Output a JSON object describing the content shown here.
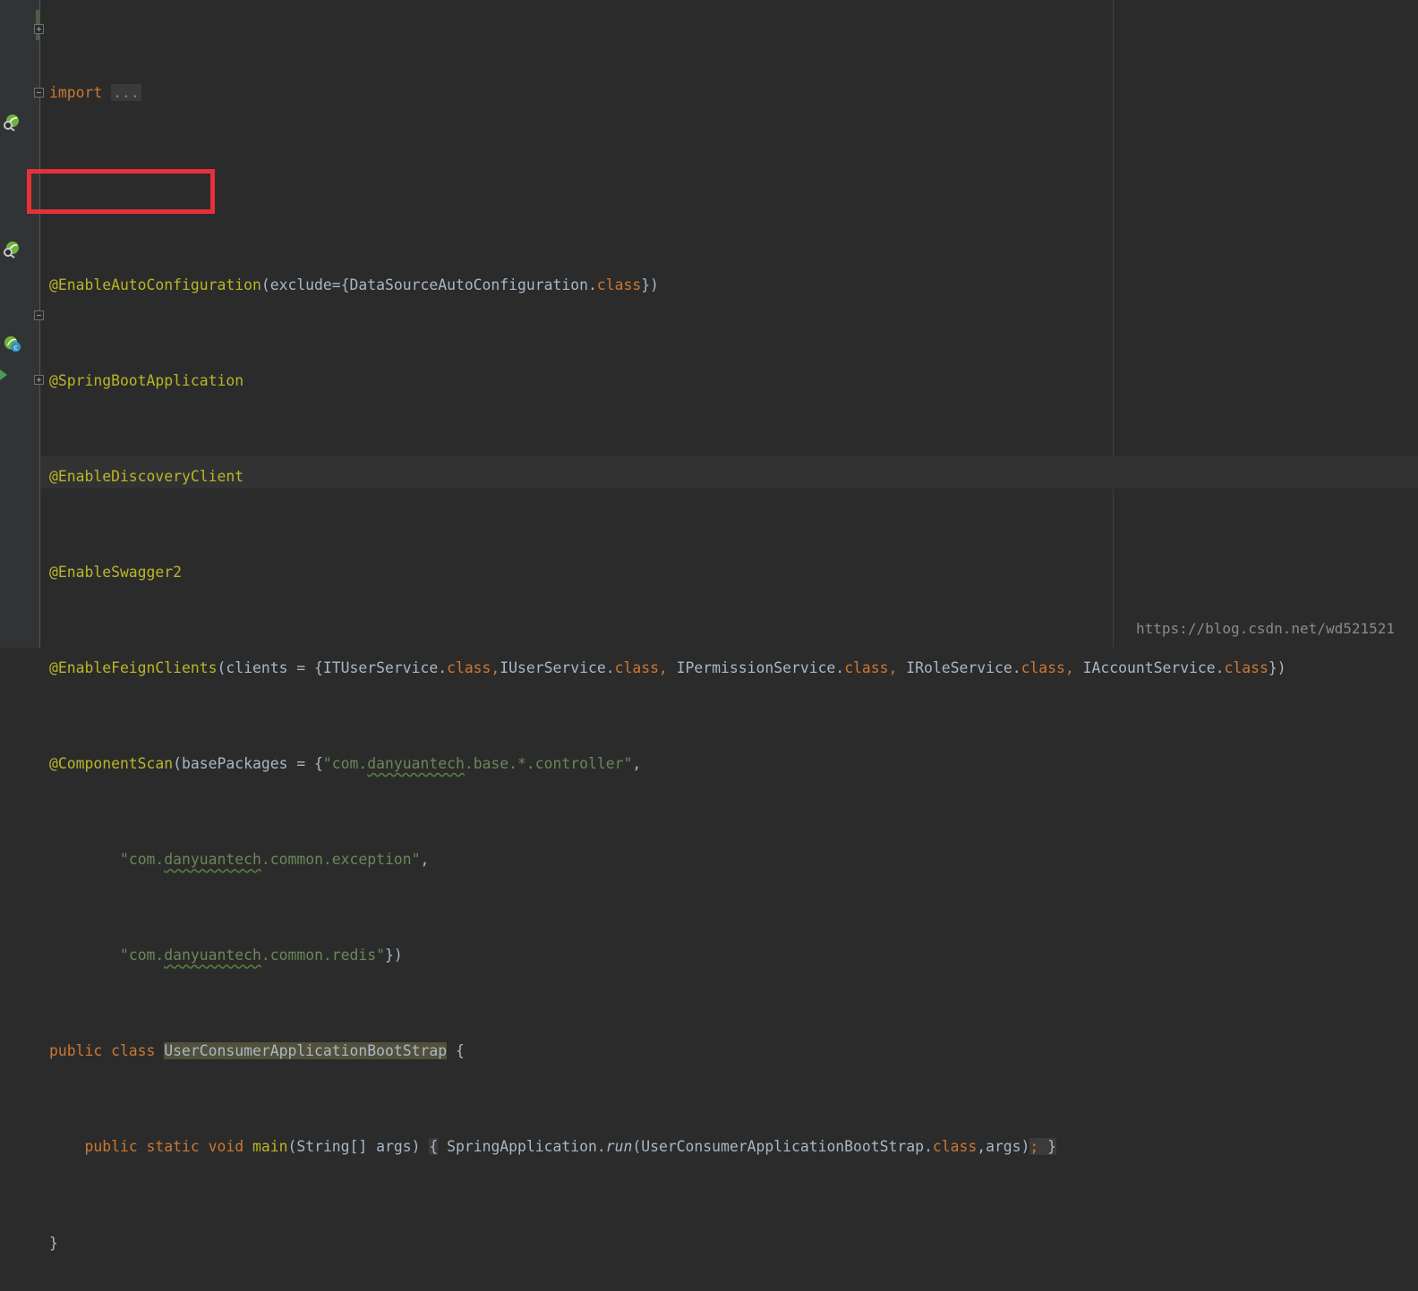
{
  "editor": {
    "lines": {
      "l1": {
        "import_kw": "import",
        "folded": "..."
      },
      "l2": "",
      "l3": {
        "ann": "@EnableAutoConfiguration",
        "p1": "(exclude={",
        "cls": "DataSourceAutoConfiguration.",
        "kw": "class",
        "p2": "})"
      },
      "l4": {
        "ann": "@SpringBootApplication"
      },
      "l5": {
        "ann": "@EnableDiscoveryClient"
      },
      "l6": {
        "ann": "@EnableSwagger2"
      },
      "l7": {
        "ann": "@EnableFeignClients",
        "p1": "(clients = {",
        "c1": "ITUserService.",
        "k1": "class,",
        "c2": "IUserService.",
        "k2": "class,",
        "c3": " IPermissionService.",
        "k3": "class,",
        "c4": " IRoleService.",
        "k4": "class,",
        "c5": " IAccountService.",
        "k5": "class",
        "p2": "})"
      },
      "l8": {
        "ann": "@ComponentScan",
        "p1": "(basePackages = {",
        "s1": "\"com.",
        "s1t": "danyuantech",
        "s1r": ".base.*.controller\"",
        "p2": ","
      },
      "l9": {
        "indent": "        ",
        "s1": "\"com.",
        "s1t": "danyuantech",
        "s1r": ".common.exception\"",
        "p2": ","
      },
      "l10": {
        "indent": "        ",
        "s1": "\"com.",
        "s1t": "danyuantech",
        "s1r": ".common.redis\"",
        "p2": "})"
      },
      "l11": {
        "k1": "public class ",
        "cls": "UserConsumerApplicationBootStrap",
        "p": " {"
      },
      "l12": {
        "indent": "    ",
        "k1": "public static void ",
        "m": "main",
        "p1": "(String[] args) ",
        "b1": "{",
        "t1": " SpringApplication.",
        "run": "run",
        "t2": "(UserConsumerApplicationBootStrap.",
        "k2": "class",
        "t3": ",args)",
        "semi": ";",
        "b2": " }"
      },
      "l13": "}"
    }
  },
  "watermark": "https://blog.csdn.net/wd521521",
  "colors": {
    "background": "#2b2b2b",
    "keyword": "#cc7832",
    "annotation": "#bbb529",
    "string": "#6a8759",
    "text": "#a9b7c6",
    "highlight_box": "#e8303a"
  },
  "icons": {
    "fold_collapsed": "plus-box-icon",
    "fold_expanded": "minus-box-icon",
    "spring_bean": "spring-bean-search-icon",
    "spring_class": "spring-class-icon",
    "run": "run-arrow-icon"
  }
}
